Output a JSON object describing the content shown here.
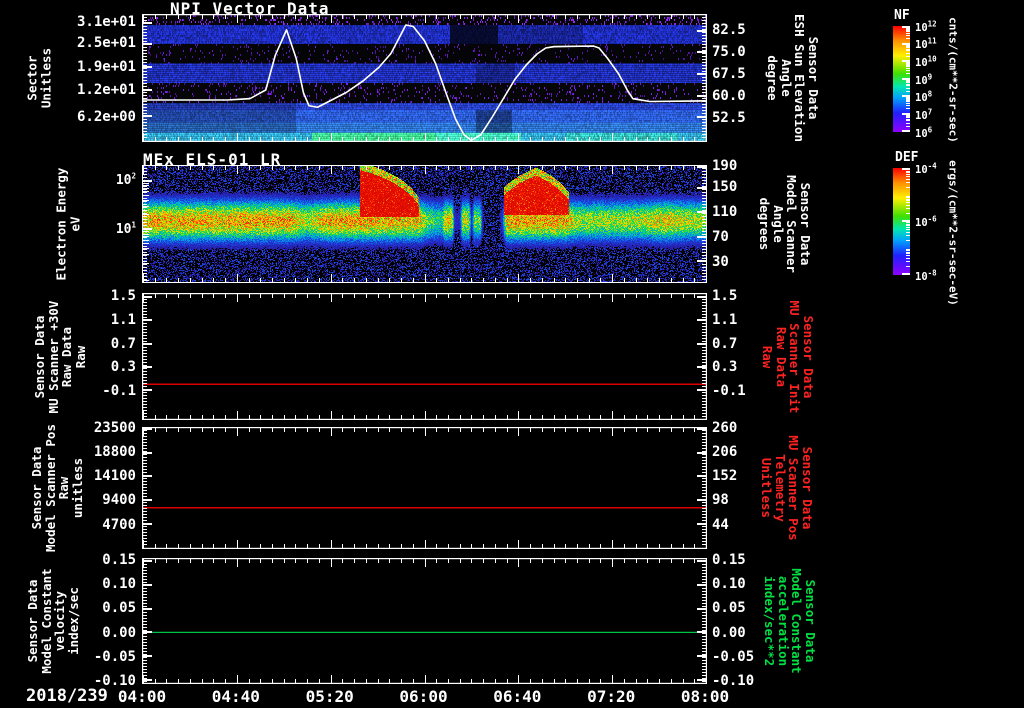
{
  "date_label": "2018/239",
  "time_axis": {
    "tick_labels": [
      "04:00",
      "04:40",
      "05:20",
      "06:00",
      "06:40",
      "07:20",
      "08:00"
    ],
    "minor_tick_minutes": 5,
    "major_tick_minutes": 40
  },
  "panels": [
    {
      "key": "npi-vector-data",
      "title": "NPI Vector Data",
      "left_label_lines": [
        "Sector",
        "Unitless"
      ],
      "left_ticks": [
        "3.1e+01",
        "2.5e+01",
        "1.9e+01",
        "1.2e+01",
        "6.2e+00"
      ],
      "right_ticks": [
        "82.5",
        "75.0",
        "67.5",
        "60.0",
        "52.5"
      ],
      "right_label_lines": [
        "Sensor Data",
        "ESH Sun Elevation",
        "Angle",
        "degree"
      ],
      "right_label_color": "#ffffff",
      "colorbar": {
        "title": "NF",
        "base": 10,
        "exponents": [
          12,
          11,
          10,
          9,
          8,
          7,
          6
        ],
        "unit": "cnts/(cm**2-sr-sec)"
      }
    },
    {
      "key": "mex-els-01-lr",
      "title": "MEx ELS-01 LR",
      "left_label_lines": [
        "Electron Energy",
        "eV"
      ],
      "left_ticks_exponents": [
        2,
        1
      ],
      "right_ticks": [
        "190",
        "150",
        "110",
        "70",
        "30"
      ],
      "right_label_lines": [
        "Sensor Data",
        "Model Scanner",
        "Angle",
        "degrees"
      ],
      "right_label_color": "#ffffff",
      "colorbar": {
        "title": "DEF",
        "base": 10,
        "exponents": [
          -4,
          -6,
          -8
        ],
        "unit": "ergs/(cm**2-sr-sec-eV)"
      }
    },
    {
      "key": "mu-scanner-30v",
      "title": "",
      "left_label_lines": [
        "Sensor Data",
        "MU Scanner +30V",
        "Raw Data",
        "Raw"
      ],
      "left_ticks": [
        "1.5",
        "1.1",
        "0.7",
        "0.3",
        "-0.1"
      ],
      "right_ticks": [
        "1.5",
        "1.1",
        "0.7",
        "0.3",
        "-0.1"
      ],
      "right_label_lines": [
        "Sensor Data",
        "MU Scanner Init",
        "Raw Data",
        "Raw"
      ],
      "right_label_color": "#ff2222"
    },
    {
      "key": "model-scanner-pos",
      "title": "",
      "left_label_lines": [
        "Sensor Data",
        "Model Scanner Pos",
        "Raw",
        "unitless"
      ],
      "left_ticks": [
        "23500",
        "18800",
        "14100",
        "9400",
        "4700"
      ],
      "right_ticks": [
        "260",
        "206",
        "152",
        "98",
        "44"
      ],
      "right_label_lines": [
        "Sensor Data",
        "MU Scanner Pos",
        "Telemetry",
        "Unitless"
      ],
      "right_label_color": "#ff2222"
    },
    {
      "key": "model-constant",
      "title": "",
      "left_label_lines": [
        "Sensor Data",
        "Model Constant",
        "velocity",
        "index/sec"
      ],
      "left_ticks": [
        "0.15",
        "0.10",
        "0.05",
        "0.00",
        "-0.05",
        "-0.10"
      ],
      "right_ticks": [
        "0.15",
        "0.10",
        "0.05",
        "0.00",
        "-0.05",
        "-0.10"
      ],
      "right_label_lines": [
        "Sensor Data",
        "Model Constant",
        "acceleration",
        "index/sec**2"
      ],
      "right_label_color": "#00e044"
    }
  ],
  "chart_data": [
    {
      "panel": "NPI Vector Data",
      "type": "heatmap",
      "x_ticks": [
        "04:00",
        "04:40",
        "05:20",
        "06:00",
        "06:40",
        "07:20",
        "08:00"
      ],
      "date": "2018/239",
      "y_axis": {
        "label": "Sector Unitless",
        "ticks": [
          31,
          25,
          19,
          12,
          6.2
        ]
      },
      "colorbar": {
        "name": "NF",
        "unit": "cnts/(cm**2-sr-sec)",
        "range_exponents": [
          6,
          12
        ]
      },
      "sector_bands": [
        {
          "y": [
            0.0,
            0.08
          ],
          "base": "#050507",
          "speckle": {
            "color": "#7a22d8",
            "density": 0.15
          }
        },
        {
          "y": [
            0.08,
            0.23
          ],
          "base": "#1f2ec2",
          "noise": 0.3,
          "segs": [
            {
              "x": [
                0.545,
                0.63
              ],
              "f": 0.25
            },
            {
              "x": [
                0.63,
                0.78
              ],
              "f": 0.8
            }
          ]
        },
        {
          "y": [
            0.23,
            0.385
          ],
          "base": "#050508",
          "speckle": {
            "color": "#5518a8",
            "density": 0.06
          }
        },
        {
          "y": [
            0.385,
            0.54
          ],
          "base": "#2334cc",
          "noise": 0.28,
          "segs": [
            {
              "x": [
                0.59,
                0.66
              ],
              "f": 0.75
            }
          ]
        },
        {
          "y": [
            0.54,
            0.7
          ],
          "base": "#060609",
          "speckle": {
            "color": "#6a1cc8",
            "density": 0.09
          }
        },
        {
          "y": [
            0.7,
            0.755
          ],
          "base": "#2a46d8",
          "noise": 0.25,
          "segs": [
            {
              "x": [
                0.0,
                0.27
              ],
              "f": 0.8
            }
          ]
        },
        {
          "y": [
            0.755,
            0.855
          ],
          "base": "#2e62e4",
          "noise": 0.22,
          "segs": [
            {
              "x": [
                0.0,
                0.27
              ],
              "f": 0.75
            },
            {
              "x": [
                0.59,
                0.655
              ],
              "f": 0.6
            }
          ]
        },
        {
          "y": [
            0.855,
            0.935
          ],
          "base": "#3380e8",
          "noise": 0.2,
          "segs": [
            {
              "x": [
                0.0,
                0.27
              ],
              "f": 0.8
            },
            {
              "x": [
                0.59,
                0.655
              ],
              "f": 0.65
            }
          ]
        },
        {
          "y": [
            0.935,
            1.0
          ],
          "base": "#35b8e2",
          "noise": 0.25,
          "segs": [
            {
              "x": [
                0.3,
                0.52
              ],
              "f": 1.1,
              "color": "#3ee08a"
            },
            {
              "x": [
                0.52,
                0.67
              ],
              "f": 1.15,
              "color": "#40e8b0"
            },
            {
              "x": [
                0.75,
                0.95
              ],
              "f": 1.0,
              "color": "#38d0c8"
            }
          ]
        }
      ],
      "overlay_line": {
        "name": "Sensor Data ESH Sun Elevation Angle",
        "unit": "degree",
        "color": "#ffffff",
        "right_axis_calibration": [
          [
            0.125,
            82.5
          ],
          [
            0.8125,
            52.5
          ]
        ],
        "points_time_frac_degree": [
          [
            0.0,
            58.5
          ],
          [
            0.15,
            58.5
          ],
          [
            0.19,
            59
          ],
          [
            0.218,
            62
          ],
          [
            0.235,
            74
          ],
          [
            0.255,
            82.8
          ],
          [
            0.272,
            73
          ],
          [
            0.285,
            61
          ],
          [
            0.295,
            56.5
          ],
          [
            0.31,
            56
          ],
          [
            0.33,
            58
          ],
          [
            0.36,
            61
          ],
          [
            0.39,
            65
          ],
          [
            0.42,
            70
          ],
          [
            0.44,
            74.5
          ],
          [
            0.455,
            80
          ],
          [
            0.467,
            84.5
          ],
          [
            0.48,
            84
          ],
          [
            0.5,
            79
          ],
          [
            0.52,
            71
          ],
          [
            0.54,
            60
          ],
          [
            0.555,
            52
          ],
          [
            0.57,
            46.5
          ],
          [
            0.583,
            44.5
          ],
          [
            0.6,
            46.5
          ],
          [
            0.62,
            52.5
          ],
          [
            0.64,
            59
          ],
          [
            0.66,
            65.5
          ],
          [
            0.68,
            70.5
          ],
          [
            0.7,
            74.5
          ],
          [
            0.715,
            76.5
          ],
          [
            0.73,
            77
          ],
          [
            0.8,
            77.2
          ],
          [
            0.81,
            76.5
          ],
          [
            0.825,
            73
          ],
          [
            0.845,
            67.5
          ],
          [
            0.86,
            62
          ],
          [
            0.87,
            59
          ],
          [
            0.9,
            58
          ],
          [
            1.0,
            58.2
          ]
        ]
      }
    },
    {
      "panel": "MEx ELS-01 LR",
      "type": "heatmap",
      "y_axis": {
        "label": "Electron Energy eV",
        "scale": "log",
        "range_eV": [
          0.8,
          200
        ],
        "tick_exponents": [
          2,
          1
        ]
      },
      "colorbar": {
        "name": "DEF",
        "unit": "ergs/(cm**2-sr-sec-eV)",
        "range_exponents": [
          -8,
          -4
        ]
      },
      "band_center_eV": 15,
      "band_sigma_log10": 0.3,
      "band_peak_level": 0.82,
      "amplitude_vs_time": [
        [
          0,
          1.0
        ],
        [
          0.26,
          1.0
        ],
        [
          0.29,
          0.82
        ],
        [
          0.33,
          1.0
        ],
        [
          0.38,
          1.0
        ],
        [
          0.49,
          0.95
        ],
        [
          0.505,
          0.72
        ],
        [
          0.53,
          0.6
        ],
        [
          0.535,
          0.9
        ],
        [
          0.548,
          0.9
        ],
        [
          0.553,
          0.22
        ],
        [
          0.562,
          0.22
        ],
        [
          0.567,
          0.85
        ],
        [
          0.578,
          0.85
        ],
        [
          0.583,
          0.2
        ],
        [
          0.588,
          0.75
        ],
        [
          0.598,
          0.75
        ],
        [
          0.603,
          0.15
        ],
        [
          0.63,
          0.1
        ],
        [
          0.638,
          0.3
        ],
        [
          0.645,
          1.0
        ],
        [
          0.75,
          1.0
        ],
        [
          0.77,
          0.8
        ],
        [
          0.88,
          0.82
        ],
        [
          0.93,
          0.95
        ],
        [
          0.96,
          0.85
        ],
        [
          1,
          0.82
        ]
      ],
      "hot_blobs": [
        {
          "x": [
            0.385,
            0.49
          ],
          "top_eV": [
            170,
            30
          ],
          "bottom_eV": 18,
          "level": 1.35
        },
        {
          "x": [
            0.64,
            0.755
          ],
          "top_eV": [
            50,
            130,
            40
          ],
          "bottom_eV": 20,
          "level": 1.3
        }
      ]
    },
    {
      "panel": "Sensor Data MU Scanner +30V Raw Data Raw",
      "type": "line",
      "y_ticks": [
        1.5,
        1.1,
        0.7,
        0.3,
        -0.1
      ],
      "series": [
        {
          "name": "MU Scanner +30V Raw (left) / MU Scanner Init Raw (right)",
          "color": "#dd0000",
          "constant_value": 0.0
        }
      ]
    },
    {
      "panel": "Sensor Data Model Scanner Pos Raw unitless",
      "type": "line",
      "y_ticks_left": [
        23500,
        18800,
        14100,
        9400,
        4700
      ],
      "y_ticks_right": [
        260,
        206,
        152,
        98,
        44
      ],
      "series": [
        {
          "name": "Model Scanner Pos Raw / MU Scanner Pos Telemetry",
          "color": "#dd0000",
          "constant_value": 8100
        }
      ]
    },
    {
      "panel": "Sensor Data Model Constant velocity index/sec",
      "type": "line",
      "y_ticks": [
        0.15,
        0.1,
        0.05,
        0.0,
        -0.05,
        -0.1
      ],
      "series": [
        {
          "name": "Model Constant velocity / acceleration",
          "color": "#00c244",
          "constant_value": 0.0
        }
      ]
    }
  ]
}
